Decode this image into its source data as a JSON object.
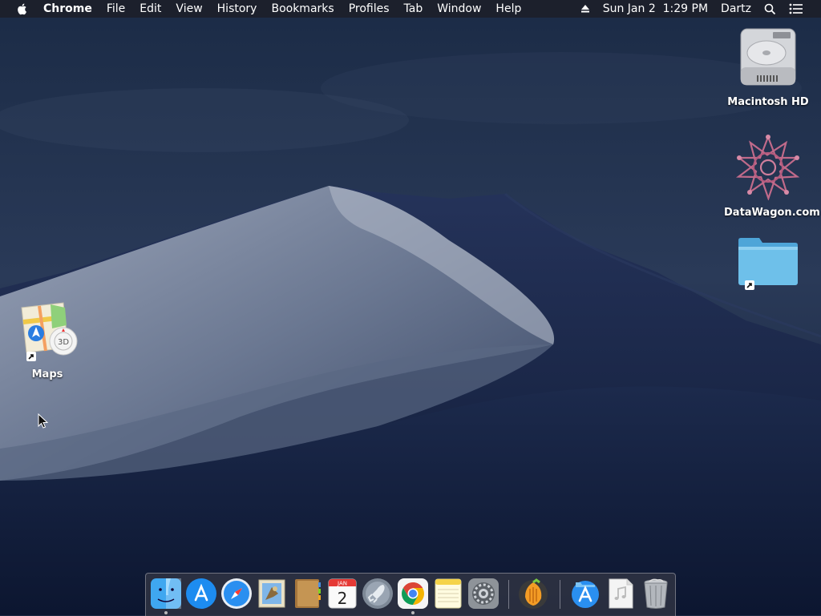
{
  "menubar": {
    "app_name": "Chrome",
    "menus": [
      "File",
      "Edit",
      "View",
      "History",
      "Bookmarks",
      "Profiles",
      "Tab",
      "Window",
      "Help"
    ],
    "clock": "Sun Jan 2  1:29 PM",
    "user": "Dartz"
  },
  "desktop": {
    "icons": [
      {
        "label": "Macintosh HD",
        "icon": "hard-drive-icon"
      },
      {
        "label": "DataWagon.com",
        "icon": "datawagon-star-icon"
      },
      {
        "label": "",
        "icon": "folder-icon"
      },
      {
        "label": "Maps",
        "icon": "maps-icon"
      }
    ]
  },
  "dock": {
    "apps": [
      {
        "name": "Finder",
        "icon": "finder-icon",
        "running": true
      },
      {
        "name": "App Store",
        "icon": "app-store-icon",
        "running": false
      },
      {
        "name": "Safari",
        "icon": "safari-icon",
        "running": false
      },
      {
        "name": "Mail",
        "icon": "mail-icon",
        "running": false
      },
      {
        "name": "Contacts",
        "icon": "contacts-icon",
        "running": false
      },
      {
        "name": "Calendar",
        "icon": "calendar-icon",
        "running": false,
        "badge_month": "JAN",
        "badge_day": "2"
      },
      {
        "name": "Launchpad",
        "icon": "launchpad-icon",
        "running": false
      },
      {
        "name": "Chrome",
        "icon": "chrome-icon",
        "running": true
      },
      {
        "name": "Notes",
        "icon": "notes-icon",
        "running": false
      },
      {
        "name": "System Preferences",
        "icon": "system-preferences-icon",
        "running": false
      },
      {
        "name": "FL Studio",
        "icon": "fl-studio-icon",
        "running": false
      },
      {
        "name": "Applications",
        "icon": "applications-folder-icon",
        "running": false
      },
      {
        "name": "Music Document",
        "icon": "music-document-icon",
        "running": false
      },
      {
        "name": "Trash",
        "icon": "trash-icon",
        "running": false
      }
    ]
  },
  "colors": {
    "menubar_bg": "#1c202a",
    "sky_top": "#1a2a45",
    "dune_light": "#8b97ad",
    "folder_blue": "#5fb6e6"
  }
}
